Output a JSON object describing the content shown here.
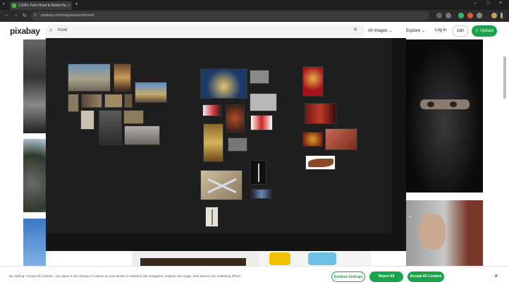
{
  "browser": {
    "tab_title": "2,030+ Free Hood & Robin Ho...",
    "tab_close": "×",
    "new_tab": "+",
    "url": "pixabay.com/images/search/hood/"
  },
  "header": {
    "logo": "pixabay",
    "search_value": "hood",
    "filter_label": "All images",
    "explore_label": "Explore",
    "login_label": "Log in",
    "join_label": "Join",
    "upload_label": "Upload"
  },
  "cookie_banner": {
    "message": "By clicking \"Accept All Cookies\", you agree to the storing of cookies on your device to enhance site navigation, analyze site usage, and assist in our marketing efforts.",
    "settings_label": "Cookies Settings",
    "reject_label": "Reject All",
    "accept_label": "Accept All Cookies",
    "close_label": "×"
  },
  "colors": {
    "brand_green": "#1aa34a",
    "overlay_bg": "#141414"
  },
  "icons": [
    "search-icon",
    "close-icon",
    "chevron-down-icon",
    "upload-icon",
    "lock-icon",
    "back-icon",
    "forward-icon",
    "reload-icon"
  ]
}
